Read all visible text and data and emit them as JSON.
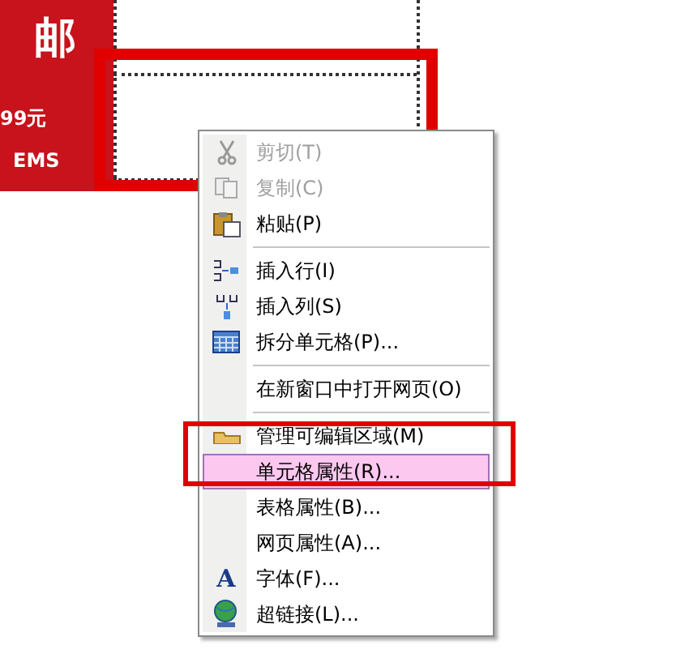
{
  "banner": {
    "headline": "邮",
    "price": "99元",
    "shipping": "EMS"
  },
  "context_menu": {
    "items": [
      {
        "kind": "item",
        "label": "剪切(T)",
        "disabled": true,
        "selected": false
      },
      {
        "kind": "item",
        "label": "复制(C)",
        "disabled": true,
        "selected": false
      },
      {
        "kind": "item",
        "label": "粘贴(P)",
        "disabled": false,
        "selected": false
      },
      {
        "kind": "separator"
      },
      {
        "kind": "item",
        "label": "插入行(I)",
        "disabled": false,
        "selected": false
      },
      {
        "kind": "item",
        "label": "插入列(S)",
        "disabled": false,
        "selected": false
      },
      {
        "kind": "item",
        "label": "拆分单元格(P)...",
        "disabled": false,
        "selected": false
      },
      {
        "kind": "separator"
      },
      {
        "kind": "item",
        "label": "在新窗口中打开网页(O)",
        "disabled": false,
        "selected": false
      },
      {
        "kind": "separator"
      },
      {
        "kind": "item",
        "label": "管理可编辑区域(M)",
        "disabled": false,
        "selected": false
      },
      {
        "kind": "item",
        "label": "单元格属性(R)...",
        "disabled": false,
        "selected": true
      },
      {
        "kind": "item",
        "label": "表格属性(B)...",
        "disabled": false,
        "selected": false
      },
      {
        "kind": "item",
        "label": "网页属性(A)...",
        "disabled": false,
        "selected": false
      },
      {
        "kind": "item",
        "icon_char": "A",
        "label": "字体(F)...",
        "disabled": false,
        "selected": false
      },
      {
        "kind": "item",
        "label": "超链接(L)...",
        "disabled": false,
        "selected": false
      }
    ]
  }
}
